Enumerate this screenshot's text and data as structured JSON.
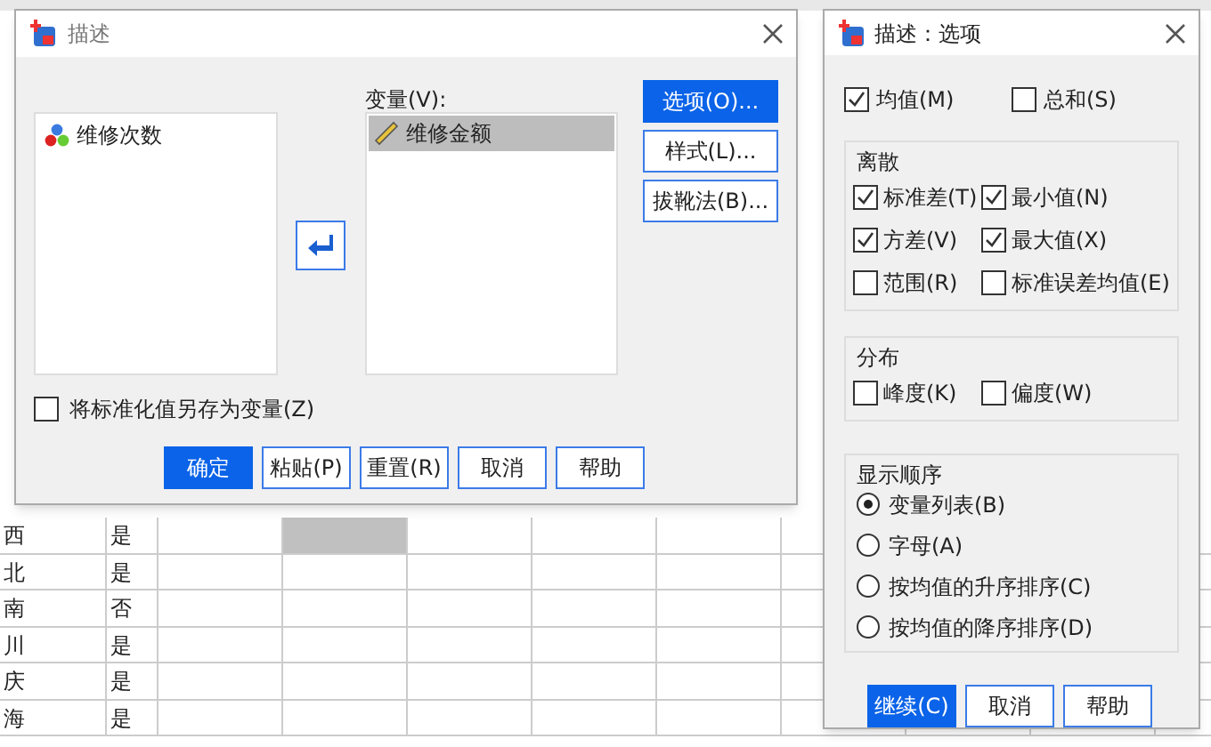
{
  "spreadsheet": {
    "rows": [
      {
        "column_1": "西",
        "column_2": "是",
        "selected": true
      },
      {
        "column_1": "北",
        "column_2": "是",
        "selected": false
      },
      {
        "column_1": "南",
        "column_2": "否",
        "selected": false
      },
      {
        "column_1": "川",
        "column_2": "是",
        "selected": false
      },
      {
        "column_1": "庆",
        "column_2": "是",
        "selected": false
      },
      {
        "column_1": "海",
        "column_2": "是",
        "selected": false
      }
    ]
  },
  "main_dialog": {
    "title": "描述",
    "source_list": [
      {
        "label": "维修次数",
        "kind": "nominal"
      }
    ],
    "variables_label": "变量(V):",
    "variables_list": [
      {
        "label": "维修金额",
        "kind": "scale",
        "selected": true
      }
    ],
    "side_buttons": [
      {
        "label": "选项(O)...",
        "selected": true
      },
      {
        "label": "样式(L)...",
        "selected": false
      },
      {
        "label": "拔靴法(B)...",
        "selected": false
      }
    ],
    "save_standardized": {
      "label": "将标准化值另存为变量(Z)",
      "checked": false
    },
    "buttons": [
      {
        "label": "确定",
        "selected": true
      },
      {
        "label": "粘贴(P)",
        "selected": false
      },
      {
        "label": "重置(R)",
        "selected": false
      },
      {
        "label": "取消",
        "selected": false
      },
      {
        "label": "帮助",
        "selected": false
      }
    ]
  },
  "options_dialog": {
    "title": "描述：选项",
    "top_options": [
      {
        "label": "均值(M)",
        "checked": true
      },
      {
        "label": "总和(S)",
        "checked": false
      }
    ],
    "groups": [
      {
        "title": "离散",
        "options": [
          {
            "label": "标准差(T)",
            "checked": true
          },
          {
            "label": "最小值(N)",
            "checked": true
          },
          {
            "label": "方差(V)",
            "checked": true
          },
          {
            "label": "最大值(X)",
            "checked": true
          },
          {
            "label": "范围(R)",
            "checked": false
          },
          {
            "label": "标准误差均值(E)",
            "checked": false
          }
        ]
      },
      {
        "title": "分布",
        "options": [
          {
            "label": "峰度(K)",
            "checked": false
          },
          {
            "label": "偏度(W)",
            "checked": false
          }
        ]
      }
    ],
    "display_order": {
      "title": "显示顺序",
      "options": [
        {
          "label": "变量列表(B)",
          "selected": true
        },
        {
          "label": "字母(A)",
          "selected": false
        },
        {
          "label": "按均值的升序排序(C)",
          "selected": false
        },
        {
          "label": "按均值的降序排序(D)",
          "selected": false
        }
      ]
    },
    "buttons": [
      {
        "label": "继续(C)",
        "selected": true
      },
      {
        "label": "取消",
        "selected": false
      },
      {
        "label": "帮助",
        "selected": false
      }
    ]
  }
}
